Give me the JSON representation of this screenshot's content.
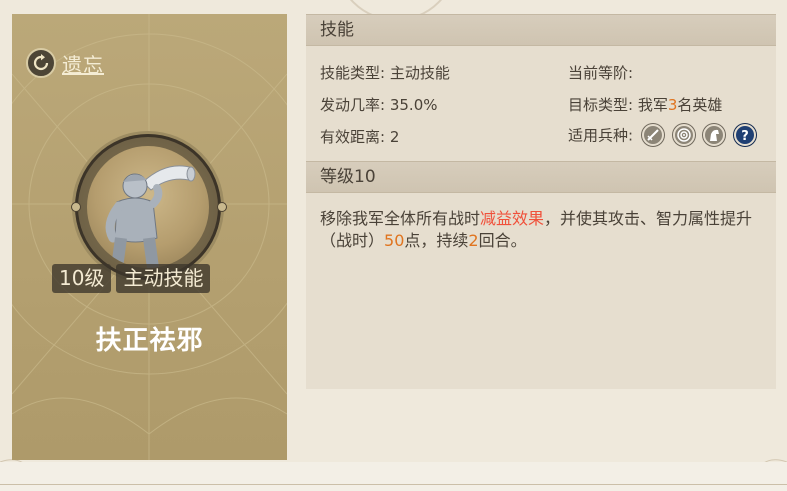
{
  "card": {
    "forget_label": "遗忘",
    "level_badge": "10级",
    "type_badge": "主动技能",
    "skill_name": "扶正祛邪"
  },
  "panel": {
    "skill_header": "技能",
    "skill_type_label": "技能类型:",
    "skill_type_value": "主动技能",
    "current_rank_label": "当前等阶:",
    "current_rank_value": "",
    "trigger_rate_label": "发动几率:",
    "trigger_rate_value": "35.0%",
    "target_type_label": "目标类型:",
    "target_prefix": "我军",
    "target_count": "3",
    "target_suffix": "名英雄",
    "range_label": "有效距离:",
    "range_value": "2",
    "unit_types_label": "适用兵种:",
    "unit_icons": [
      "infantry-sword-icon",
      "archer-target-icon",
      "cavalry-horse-icon",
      "unknown-question-icon"
    ],
    "level_header": "等级10",
    "desc_part1": "移除我军全体所有战时",
    "desc_highlight": "减益效果",
    "desc_part2": "，并使其攻击、智力属性提升（战时）",
    "desc_value": "50",
    "desc_part3": "点，持续",
    "desc_rounds": "2",
    "desc_part4": "回合。"
  },
  "colors": {
    "highlight_orange": "#e0741f",
    "highlight_red": "#f0503a",
    "card_bg": "#b4a070",
    "panel_bg": "#e6decf"
  }
}
